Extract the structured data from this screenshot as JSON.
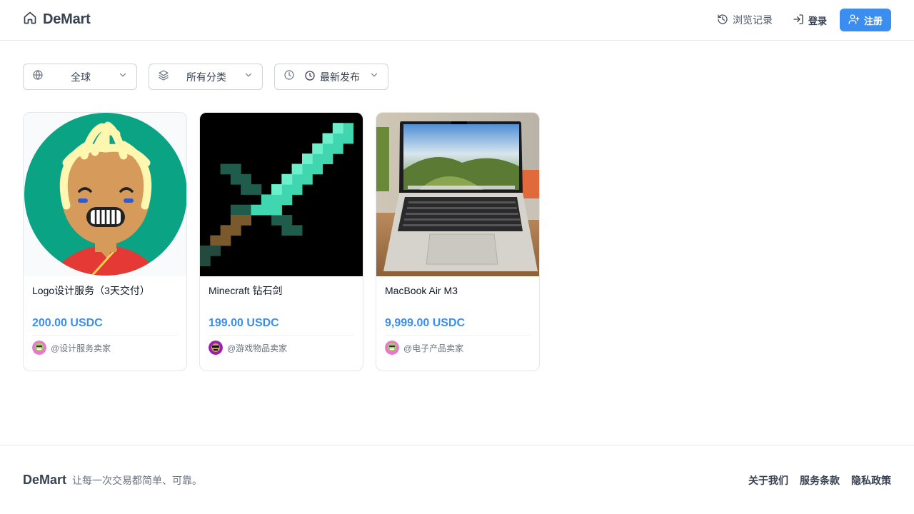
{
  "header": {
    "brand": "DeMart",
    "history_label": "浏览记录",
    "login_label": "登录",
    "register_label": "注册"
  },
  "filters": {
    "region": "全球",
    "category": "所有分类",
    "sort": "最新发布"
  },
  "products": [
    {
      "title": "Logo设计服务（3天交付）",
      "price": "200.00 USDC",
      "seller": "@设计服务卖家"
    },
    {
      "title": "Minecraft 钻石剑",
      "price": "199.00 USDC",
      "seller": "@游戏物品卖家"
    },
    {
      "title": "MacBook Air M3",
      "price": "9,999.00 USDC",
      "seller": "@电子产品卖家"
    }
  ],
  "footer": {
    "brand": "DeMart",
    "tagline": "让每一次交易都简单、可靠。",
    "links": [
      "关于我们",
      "服务条款",
      "隐私政策"
    ]
  },
  "colors": {
    "accent": "#3b8ef0",
    "border": "#e5e7eb"
  },
  "icons": {
    "brand": "home-icon",
    "history": "history-icon",
    "login": "login-icon",
    "register": "user-plus-icon",
    "region": "globe-icon",
    "category": "layers-icon",
    "sort": "clock-icon"
  }
}
